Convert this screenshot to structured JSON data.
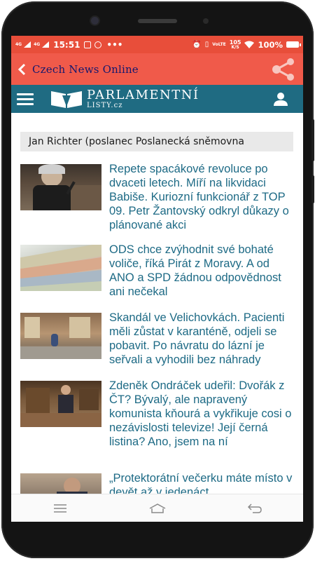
{
  "status_bar": {
    "network_1": "4G",
    "network_2": "4G",
    "time": "15:51",
    "speed_value": "105",
    "speed_unit": "K/S",
    "battery": "100%"
  },
  "app_bar": {
    "title": "Czech News Online",
    "bar_color": "#f05a4a",
    "title_color": "#15186e"
  },
  "site_header": {
    "logo_main": "PARLAMENTNÍ",
    "logo_sub": "LISTY.cz",
    "header_color": "#1f6b82"
  },
  "author_filter": {
    "text": "Jan Richter (poslanec Poslanecká sněmovna"
  },
  "articles": [
    {
      "headline": "Repete spacákové revoluce po dvaceti letech. Míří na likvidaci Babiše. Kuriozní funkcionář z TOP 09. Petr Žantovský odkryl důkazy o plánované akci",
      "thumb": "man-speaking-at-podium"
    },
    {
      "headline": "ODS chce zvýhodnit své bohaté voliče, říká Pirát z Moravy. A od ANO a SPD žádnou odpovědnost ani nečekal",
      "thumb": "banknotes"
    },
    {
      "headline": "Skandál ve Velichovkách. Pacienti měli zůstat v karanténě, odjeli se pobavit. Po návratu do lázní je seřvali a vyhodili bez náhrady",
      "thumb": "spa-lobby"
    },
    {
      "headline": "Zdeněk Ondráček udeřil: Dvořák z ČT? Bývalý, ale napravený komunista kňourá a vykřikuje cosi o nezávislosti televize! Její černá listina? Ano, jsem na ní",
      "thumb": "parliament-chamber"
    },
    {
      "headline": "„Protektorátní večerku máte místo v devět až v jedenáct",
      "thumb": "man-in-street"
    }
  ],
  "headline_color": "#1d6a85"
}
